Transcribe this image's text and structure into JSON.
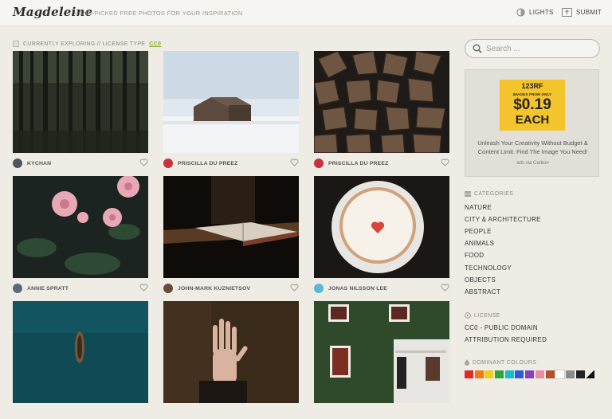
{
  "header": {
    "logo": "Magdeleine",
    "tagline": "HAND-PICKED FREE PHOTOS FOR YOUR INSPIRATION",
    "lights_label": "LIGHTS",
    "submit_label": "SUBMIT"
  },
  "explore": {
    "prefix": "CURRENTLY EXPLORING // LICENSE TYPE",
    "license": "CC0"
  },
  "photos": [
    {
      "author": "KYCHAN",
      "subject": "pine forest"
    },
    {
      "author": "PRISCILLA DU PREEZ",
      "subject": "barn in snow"
    },
    {
      "author": "PRISCILLA DU PREEZ",
      "subject": "stacked firewood"
    },
    {
      "author": "ANNIE SPRATT",
      "subject": "pink roses"
    },
    {
      "author": "JOHN-MARK KUZNIETSOV",
      "subject": "open book on table"
    },
    {
      "author": "JONAS NILSSON LEE",
      "subject": "cake with heart"
    },
    {
      "author": "",
      "subject": "boat on teal water"
    },
    {
      "author": "",
      "subject": "hand on wood"
    },
    {
      "author": "",
      "subject": "ivy covered house"
    }
  ],
  "search": {
    "placeholder": "Search ..."
  },
  "ad": {
    "brand": "123RF",
    "sub": "IMAGES FROM ONLY",
    "price": "$0.19",
    "each": "EACH",
    "text": "Unleash Your Creativity Without Budget & Content Limit. Find The Image You Need!",
    "via": "ads via Carbon"
  },
  "categories": {
    "title": "CATEGORIES",
    "items": [
      "NATURE",
      "CITY & ARCHITECTURE",
      "PEOPLE",
      "ANIMALS",
      "FOOD",
      "TECHNOLOGY",
      "OBJECTS",
      "ABSTRACT"
    ]
  },
  "license": {
    "title": "LICENSE",
    "items": [
      "CC0 - PUBLIC DOMAIN",
      "ATTRIBUTION REQUIRED"
    ]
  },
  "colours": {
    "title": "DOMINANT COLOURS",
    "swatches": [
      "#e02a2a",
      "#f07a18",
      "#f2cc1a",
      "#2aa83a",
      "#1abccd",
      "#2f5ad8",
      "#8a3fc0",
      "#e88aa8",
      "#b0522a",
      "#ffffff",
      "#8a8a8a",
      "#222222",
      "#111111"
    ]
  }
}
